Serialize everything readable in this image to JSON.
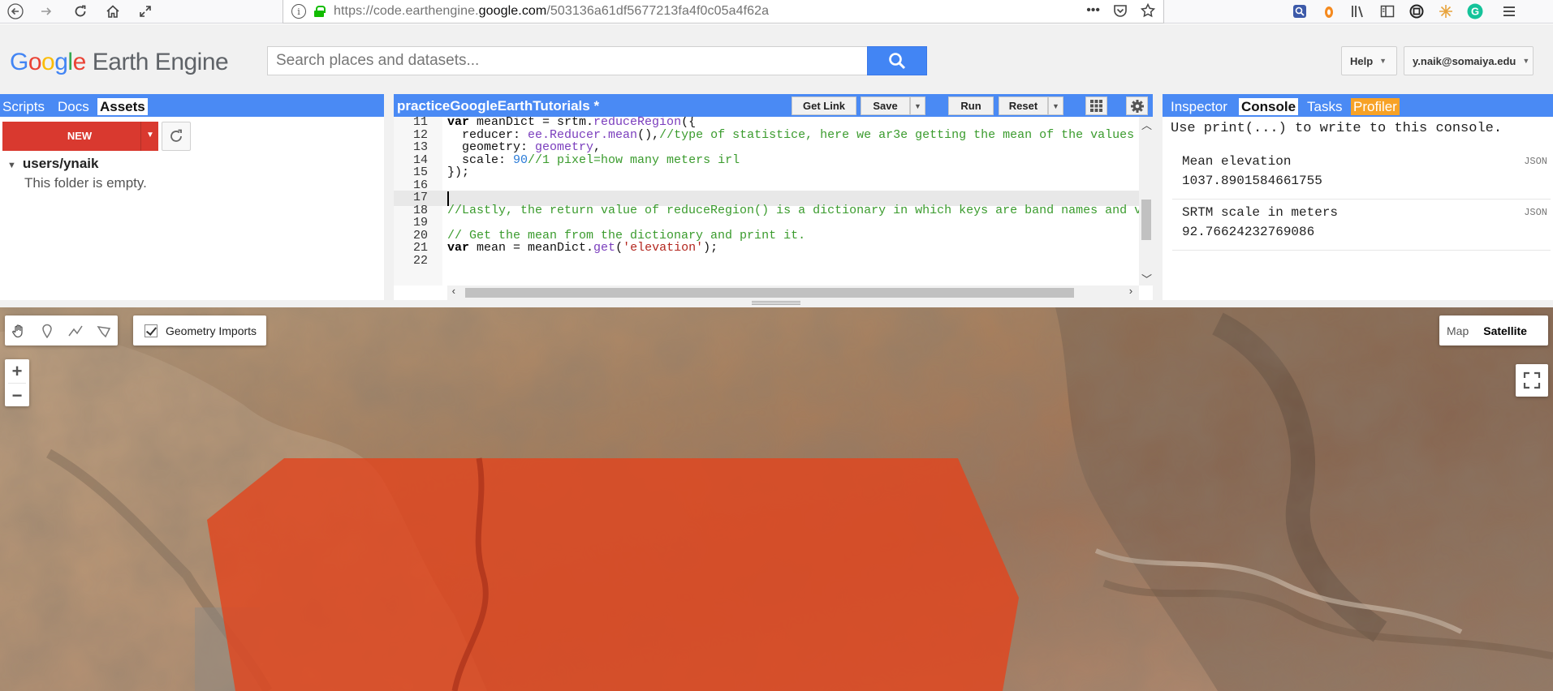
{
  "browser": {
    "url_prefix": "https://code.earthengine.",
    "url_domain": "google.com",
    "url_suffix": "/503136a61df5677213fa4f0c05a4f62a",
    "icons": [
      "back-icon",
      "forward-icon",
      "reload-icon",
      "home-icon",
      "resize-icon",
      "info-icon",
      "lock-icon",
      "more-icon",
      "pocket-icon",
      "bookmark-star-icon"
    ]
  },
  "header": {
    "logo_google": "Google",
    "logo_product": "Earth Engine",
    "search_placeholder": "Search places and datasets...",
    "help_label": "Help",
    "account_label": "y.naik@somaiya.edu"
  },
  "left_panel": {
    "tabs": [
      "Scripts",
      "Docs",
      "Assets"
    ],
    "active_tab": "Assets",
    "new_button": "NEW",
    "tree_root": "users/ynaik",
    "empty_message": "This folder is empty."
  },
  "editor": {
    "title": "practiceGoogleEarthTutorials *",
    "buttons": {
      "get_link": "Get Link",
      "save": "Save",
      "run": "Run",
      "reset": "Reset"
    },
    "lines": [
      {
        "num": "11",
        "html": "<span class='k'>var</span> meanDict = srtm.<span class='f'>reduceRegion</span>({"
      },
      {
        "num": "12",
        "html": "  reducer: <span class='f'>ee.Reducer.mean</span>(),<span class='c'>//type of statistice, here we ar3e getting the mean of the values</span>"
      },
      {
        "num": "13",
        "html": "  geometry: <span class='f'>geometry</span>,"
      },
      {
        "num": "14",
        "html": "  scale: <span class='n'>90</span><span class='c'>//1 pixel=how many meters irl</span>"
      },
      {
        "num": "15",
        "html": "});"
      },
      {
        "num": "16",
        "html": ""
      },
      {
        "num": "17",
        "html": ""
      },
      {
        "num": "18",
        "html": "<span class='c'>//Lastly, the return value of reduceRegion() is a dictionary in which keys are band names and v</span>"
      },
      {
        "num": "19",
        "html": ""
      },
      {
        "num": "20",
        "html": "<span class='c'>// Get the mean from the dictionary and print it.</span>"
      },
      {
        "num": "21",
        "html": "<span class='k'>var</span> mean = meanDict.<span class='f'>get</span>(<span class='s'>'elevation'</span>);"
      },
      {
        "num": "22",
        "html": ""
      }
    ],
    "current_line": "17"
  },
  "console": {
    "tabs": [
      "Inspector",
      "Console",
      "Tasks",
      "Profiler"
    ],
    "active_tab": "Console",
    "hint": "Use print(...) to write to this console.",
    "outputs": [
      {
        "label": "Mean elevation",
        "value": "1037.8901584661755",
        "badge": "JSON"
      },
      {
        "label": "SRTM scale in meters",
        "value": "92.76624232769086",
        "badge": "JSON"
      }
    ]
  },
  "map": {
    "geometry_imports_label": "Geometry Imports",
    "zoom_in": "+",
    "zoom_out": "−",
    "map_types": [
      "Map",
      "Satellite"
    ],
    "selected_map_type": "Satellite",
    "polygon_color": "#e0451f"
  },
  "colors": {
    "accent_blue": "#4a8af4",
    "new_red": "#d9392f",
    "profiler_orange": "#f7a226"
  }
}
